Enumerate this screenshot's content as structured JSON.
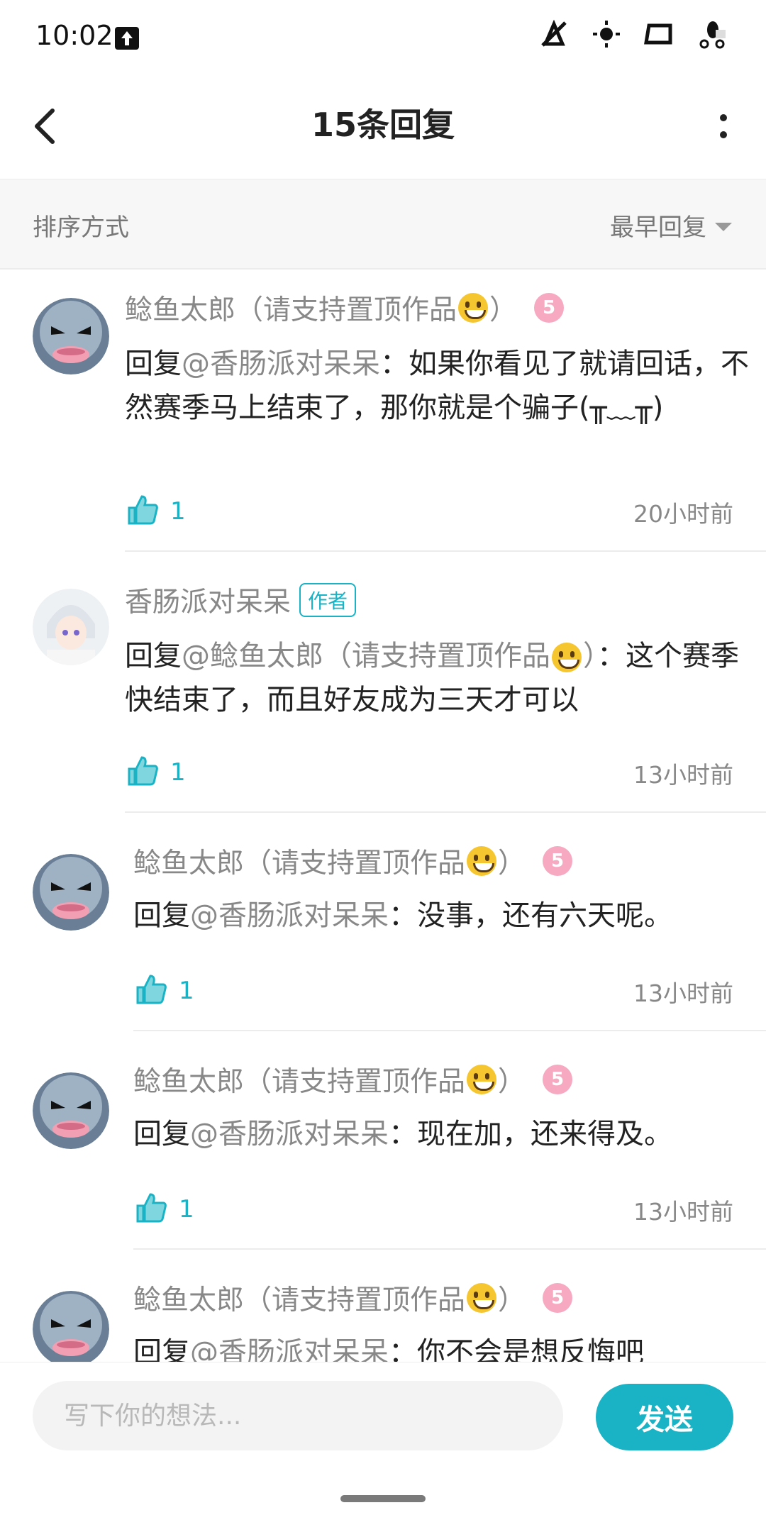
{
  "status_bar": {
    "time": "10:02"
  },
  "header": {
    "title": "15条回复"
  },
  "sort": {
    "label": "排序方式",
    "value": "最早回复"
  },
  "replies": [
    {
      "name": "鲶鱼太郎（请支持置顶作品",
      "name_tail": "）",
      "level": "5",
      "prefix": "回复",
      "mention": "@香肠派对呆呆",
      "text": "：如果你看见了就请回话，不然赛季马上结束了，那你就是个骗子(╥﹏╥)",
      "likes": "1",
      "time": "20小时前"
    },
    {
      "name": "香肠派对呆呆",
      "badge": "作者",
      "prefix": "回复",
      "mention": "@鲶鱼太郎（请支持置顶作品",
      "mention_tail": "）",
      "text": "：这个赛季快结束了，而且好友成为三天才可以",
      "likes": "1",
      "time": "13小时前"
    },
    {
      "name": "鲶鱼太郎（请支持置顶作品",
      "name_tail": "）",
      "level": "5",
      "prefix": "回复",
      "mention": "@香肠派对呆呆",
      "text": "：没事，还有六天呢。",
      "likes": "1",
      "time": "13小时前"
    },
    {
      "name": "鲶鱼太郎（请支持置顶作品",
      "name_tail": "）",
      "level": "5",
      "prefix": "回复",
      "mention": "@香肠派对呆呆",
      "text": "：现在加，还来得及。",
      "likes": "1",
      "time": "13小时前"
    },
    {
      "name": "鲶鱼太郎（请支持置顶作品",
      "name_tail": "）",
      "level": "5",
      "prefix": "回复",
      "mention": "@香肠派对呆呆",
      "text": "：你不会是想反悔吧"
    }
  ],
  "input": {
    "placeholder": "写下你的想法...",
    "send_label": "发送"
  },
  "colors": {
    "accent": "#1ab3c6",
    "level_badge": "#f7a9c2"
  }
}
